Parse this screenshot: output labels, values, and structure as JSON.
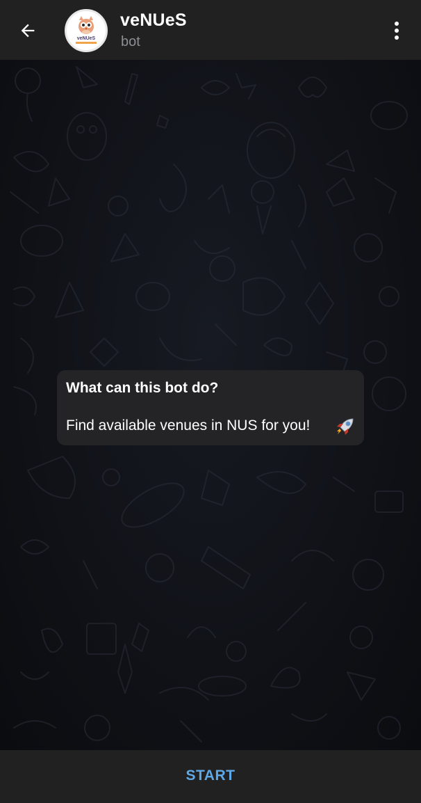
{
  "header": {
    "back_icon": "arrow-left-icon",
    "avatar_icon": "owl-logo-icon",
    "avatar_logo_text": "veNUeS",
    "title": "veNUeS",
    "subtitle": "bot",
    "menu_icon": "more-vertical-icon"
  },
  "bot_info": {
    "title": "What can this bot do?",
    "description": "Find available venues in NUS for you!",
    "emoji_icon": "rocket-icon"
  },
  "bottom_bar": {
    "start_label": "START"
  },
  "colors": {
    "header_bg": "#212121",
    "wallpaper_bg": "#0f1014",
    "card_bg": "#242426",
    "accent": "#5fa8e6",
    "text_primary": "#ffffff",
    "text_secondary": "#8d8f93"
  }
}
